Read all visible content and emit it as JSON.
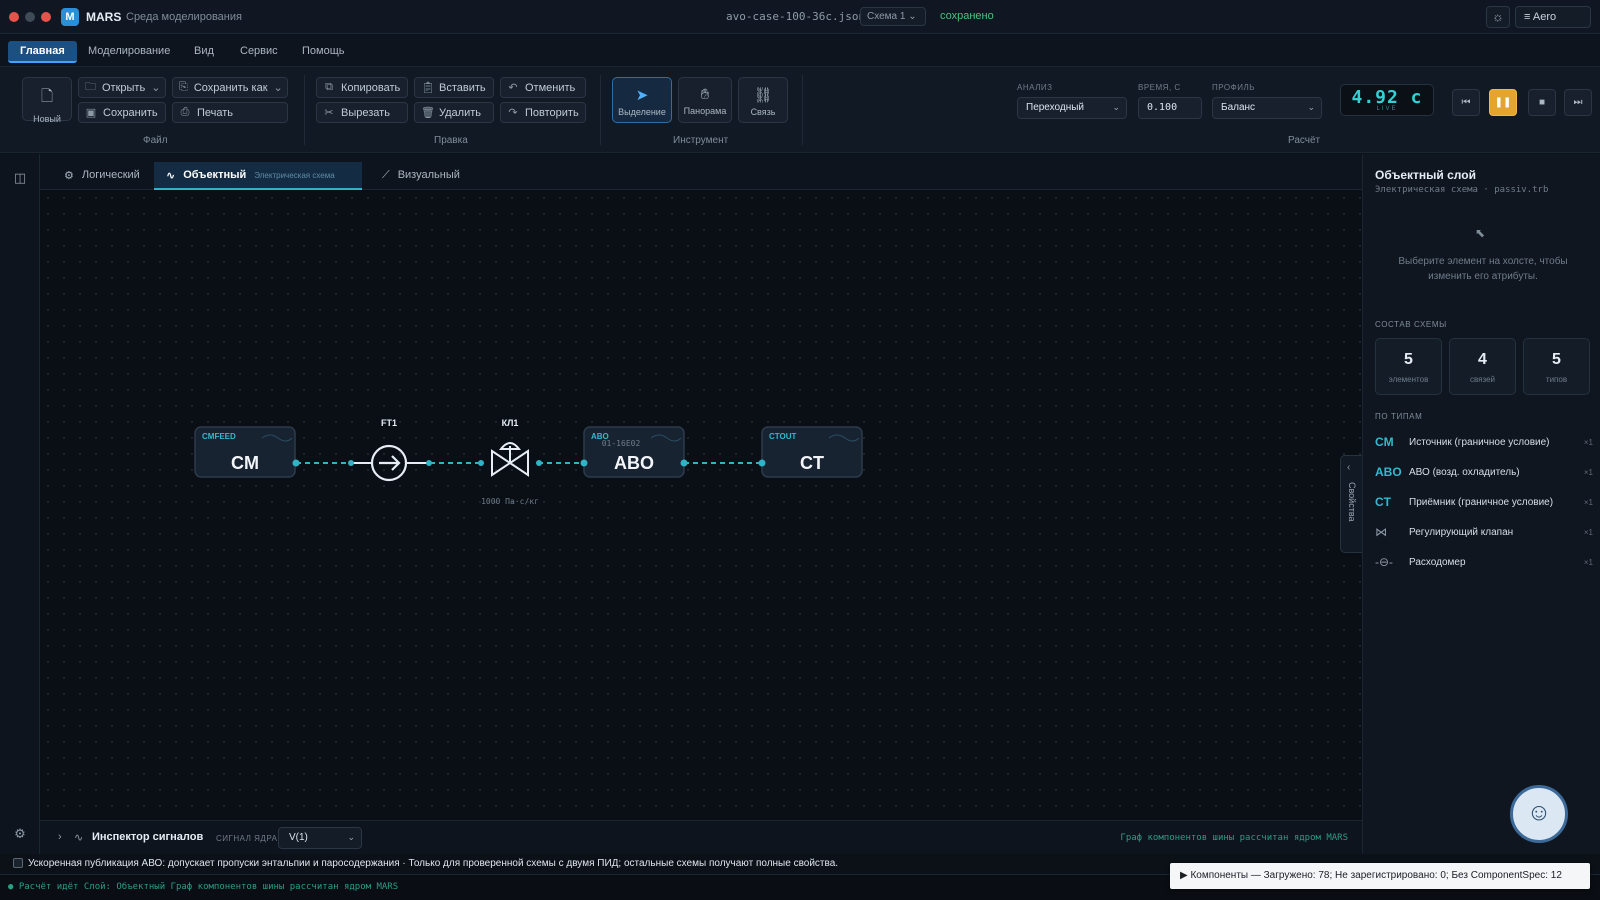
{
  "titlebar": {
    "app_name": "MARS",
    "app_subtitle": "Среда моделирования",
    "filename": "avo-case-100-36c.json",
    "schema_select": "Схема 1",
    "save_status": "сохранено",
    "profile": "Aero"
  },
  "menu": [
    "Главная",
    "Моделирование",
    "Вид",
    "Сервис",
    "Помощь"
  ],
  "ribbon": {
    "file": {
      "new": "Новый",
      "open": "Открыть",
      "save_as": "Сохранить как",
      "save": "Сохранить",
      "print": "Печать",
      "label": "Файл"
    },
    "edit": {
      "copy": "Копировать",
      "paste": "Вставить",
      "undo": "Отменить",
      "cut": "Вырезать",
      "delete": "Удалить",
      "redo": "Повторить",
      "label": "Правка"
    },
    "tools": {
      "select": "Выделение",
      "pan": "Панорама",
      "link": "Связь",
      "label": "Инструмент"
    },
    "calc": {
      "analysis_label": "АНАЛИЗ",
      "analysis_value": "Переходный",
      "time_label": "ВРЕМЯ, С",
      "time_value": "0.100",
      "profile_label": "ПРОФИЛЬ",
      "profile_value": "Баланс",
      "label": "Расчёт"
    },
    "sim_time": "4.92 с",
    "sim_live": "LIVE"
  },
  "tabs": [
    {
      "label": "Логический"
    },
    {
      "label": "Объектный",
      "sub": "Электрическая схема"
    },
    {
      "label": "Визуальный"
    }
  ],
  "diagram": {
    "cm": {
      "tag": "CMFEED",
      "name": "CM"
    },
    "ft": {
      "label": "FT1"
    },
    "valve": {
      "label": "КЛ1",
      "note": "1000 Па·с/кг"
    },
    "abo": {
      "tag": "ABO",
      "id": "01-16E02",
      "name": "ABO"
    },
    "ct": {
      "tag": "CTOUT",
      "name": "CT"
    }
  },
  "properties_tab": "Свойства",
  "inspector": {
    "title": "Инспектор сигналов",
    "signal_label": "СИГНАЛ ЯДРА",
    "signal_value": "V(1)",
    "right_text": "Граф компонентов шины рассчитан ядром MARS"
  },
  "notice": "Ускоренная публикация АВО: допускает пропуски энтальпии и паросодержания · Только для проверенной схемы с двумя ПИД; остальные схемы получают полные свойства.",
  "status": "● Расчёт идёт   Слой: Объектный   Граф компонентов шины рассчитан ядром MARS",
  "toast": "▶ Компоненты — Загружено: 78; Не зарегистрировано: 0; Без ComponentSpec: 12",
  "panel": {
    "title": "Объектный слой",
    "subtitle": "Электрическая схема · passiv.trb",
    "hint": "Выберите элемент на холсте, чтобы изменить его атрибуты.",
    "composition_label": "СОСТАВ СХЕМЫ",
    "stats": [
      {
        "n": "5",
        "l": "элементов"
      },
      {
        "n": "4",
        "l": "связей"
      },
      {
        "n": "5",
        "l": "типов"
      }
    ],
    "by_type_label": "ПО ТИПАМ",
    "types": [
      {
        "icon": "CM",
        "name": "Источник (граничное условие)",
        "count": "×1"
      },
      {
        "icon": "ABO",
        "name": "АВО (возд. охладитель)",
        "count": "×1"
      },
      {
        "icon": "CT",
        "name": "Приёмник (граничное условие)",
        "count": "×1"
      },
      {
        "icon": "valve-icon",
        "name": "Регулирующий клапан",
        "count": "×1"
      },
      {
        "icon": "flowmeter-icon",
        "name": "Расходомер",
        "count": "×1"
      }
    ]
  },
  "colors": {
    "accent": "#2fb3c5",
    "menu_active": "#1c4f82",
    "pause": "#e4a52e",
    "saved": "#4ec27a",
    "time": "#34d0d6"
  }
}
